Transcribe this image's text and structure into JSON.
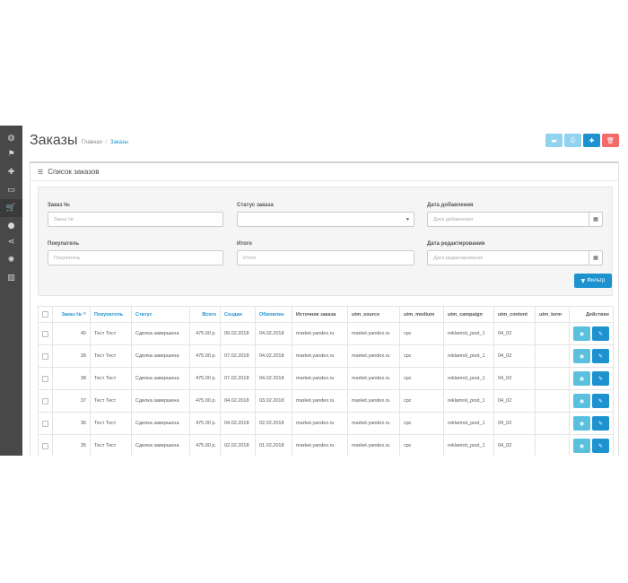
{
  "sidebar": {
    "icons": [
      "dashboard-icon",
      "tags-icon",
      "puzzle-icon",
      "monitor-icon",
      "cart-icon",
      "user-icon",
      "share-icon",
      "gear-icon",
      "chart-icon"
    ],
    "glyphs": [
      "◍",
      "⚑",
      "✚",
      "▭",
      "🛒",
      "●",
      "⋖",
      "✺",
      "▥"
    ]
  },
  "header": {
    "title": "Заказы",
    "breadcrumb": {
      "home": "Главная",
      "separator": "/",
      "current": "Заказы"
    }
  },
  "toolbar": {
    "glyphs": [
      "▬",
      "⎙",
      "✚",
      "🗑"
    ]
  },
  "panel": {
    "title": "Список заказов",
    "title_icon": "☰"
  },
  "filter": {
    "order_label": "Заказ №",
    "order_placeholder": "Заказ №",
    "status_label": "Статус заказа",
    "status_value": "",
    "date_added_label": "Дата добавления",
    "date_added_placeholder": "Дата добавления",
    "customer_label": "Покупатель",
    "customer_placeholder": "Покупатель",
    "total_label": "Итого",
    "total_placeholder": "Итого",
    "date_modified_label": "Дата редактирования",
    "date_modified_placeholder": "Дата редактирования",
    "button_label": "Фильтр",
    "caret": "▼",
    "calendar_glyph": "▦"
  },
  "table": {
    "headers": {
      "order": "Заказ № ^",
      "customer": "Покупатель",
      "status": "Статус",
      "total": "Всего",
      "created": "Создан",
      "updated": "Обновлен",
      "source": "Источник заказа",
      "utm_source": "utm_source",
      "utm_medium": "utm_medium",
      "utm_campaign": "utm_campaign",
      "utm_content": "utm_content",
      "utm_term": "utm_term",
      "action": "Действие"
    },
    "rows": [
      {
        "id": "40",
        "customer": "Тест Тест",
        "status": "Сделка завершена",
        "total": "475.00 р.",
        "created": "09.02.2018",
        "updated": "04.02.2018",
        "source": "market.yandex.ru",
        "utm_source": "market.yandex.ru",
        "utm_medium": "cpc",
        "utm_campaign": "reklamnii_post_1",
        "utm_content": "04_02",
        "utm_term": ""
      },
      {
        "id": "39",
        "customer": "Тест Тест",
        "status": "Сделка завершена",
        "total": "475.00 р.",
        "created": "07.02.2018",
        "updated": "04.02.2018",
        "source": "market.yandex.ru",
        "utm_source": "market.yandex.ru",
        "utm_medium": "cpc",
        "utm_campaign": "reklamnii_post_1",
        "utm_content": "04_02",
        "utm_term": ""
      },
      {
        "id": "38",
        "customer": "Тест Тест",
        "status": "Сделка завершена",
        "total": "475.00 р.",
        "created": "07.02.2018",
        "updated": "04.02.2018",
        "source": "market.yandex.ru",
        "utm_source": "market.yandex.ru",
        "utm_medium": "cpc",
        "utm_campaign": "reklamnii_post_1",
        "utm_content": "04_02",
        "utm_term": ""
      },
      {
        "id": "37",
        "customer": "Тест Тест",
        "status": "Сделка завершена",
        "total": "475.00 р.",
        "created": "04.02.2018",
        "updated": "03.02.2018",
        "source": "market.yandex.ru",
        "utm_source": "market.yandex.ru",
        "utm_medium": "cpc",
        "utm_campaign": "reklamnii_post_1",
        "utm_content": "04_02",
        "utm_term": ""
      },
      {
        "id": "36",
        "customer": "Тест Тест",
        "status": "Сделка завершена",
        "total": "475.00 р.",
        "created": "04.02.2018",
        "updated": "02.02.2018",
        "source": "market.yandex.ru",
        "utm_source": "market.yandex.ru",
        "utm_medium": "cpc",
        "utm_campaign": "reklamnii_post_1",
        "utm_content": "04_02",
        "utm_term": ""
      },
      {
        "id": "35",
        "customer": "Тест Тест",
        "status": "Сделка завершена",
        "total": "475.00 р.",
        "created": "02.02.2018",
        "updated": "01.02.2018",
        "source": "market.yandex.ru",
        "utm_source": "market.yandex.ru",
        "utm_medium": "cpc",
        "utm_campaign": "reklamnii_post_1",
        "utm_content": "04_02",
        "utm_term": ""
      }
    ],
    "view_glyph": "◉",
    "edit_glyph": "✎"
  },
  "colors": {
    "primary": "#1e91cf",
    "info": "#5bc0de",
    "light_info": "#8fd3ee",
    "danger": "#f56b6b",
    "sidebar": "#484848"
  }
}
